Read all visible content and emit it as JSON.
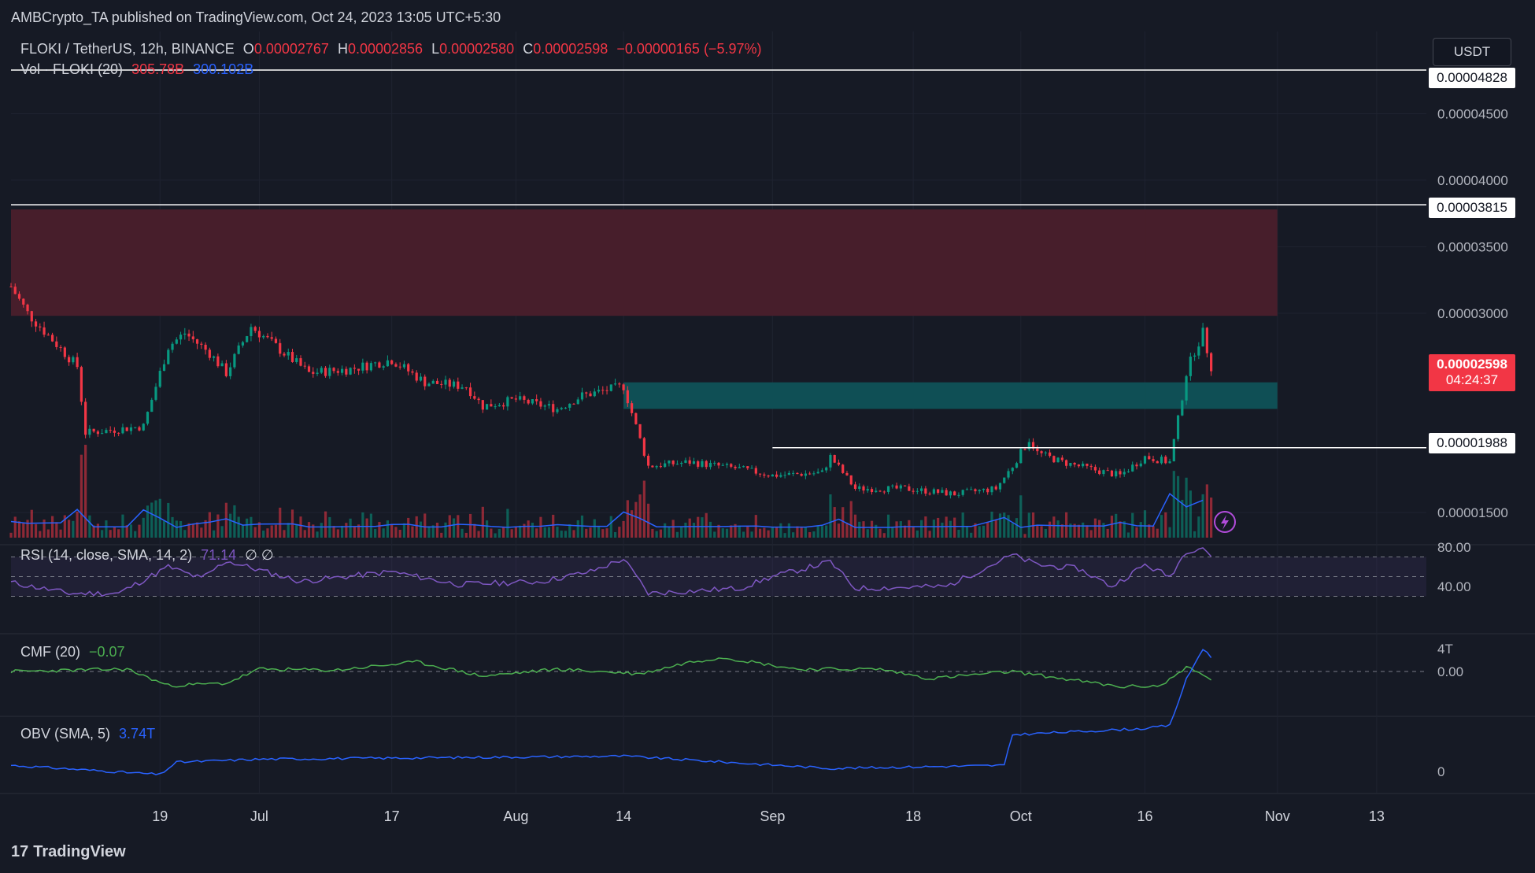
{
  "publisher": "AMBCrypto_TA published on TradingView.com, Oct 24, 2023 13:05 UTC+5:30",
  "symbol": "FLOKI / TetherUS, 12h, BINANCE",
  "ohlc": {
    "o_label": "O",
    "o": "0.00002767",
    "h_label": "H",
    "h": "0.00002856",
    "l_label": "L",
    "l": "0.00002580",
    "c_label": "C",
    "c": "0.00002598",
    "change": "−0.00000165 (−5.97%)"
  },
  "volume": {
    "label": "Vol · FLOKI (20)",
    "value": "305.78B",
    "ma": "300.102B"
  },
  "currency": "USDT",
  "price_axis": [
    "0.00004500",
    "0.00004000",
    "0.00003500",
    "0.00003000",
    "0.00001500"
  ],
  "levels": [
    "0.00004828",
    "0.00003815",
    "0.00001988"
  ],
  "current_price": {
    "value": "0.00002598",
    "countdown": "04:24:37"
  },
  "rsi": {
    "label": "RSI (14, close, SMA, 14, 2)",
    "value": "71.14",
    "extra": "∅ ∅",
    "axis": [
      "80.00",
      "40.00"
    ]
  },
  "cmf": {
    "label": "CMF (20)",
    "value": "−0.07",
    "axis": [
      "0.00"
    ]
  },
  "obv": {
    "label": "OBV (SMA, 5)",
    "value": "3.74T",
    "axis": [
      "4T",
      "0"
    ]
  },
  "time_axis": [
    "19",
    "Jul",
    "17",
    "Aug",
    "14",
    "Sep",
    "18",
    "Oct",
    "16",
    "Nov",
    "13"
  ],
  "brand": "TradingView",
  "colors": {
    "up": "#089981",
    "down": "#f23645",
    "rsi": "#7e57c2",
    "cmf": "#4caf50",
    "obv": "#2962ff",
    "bg": "#161a25"
  },
  "chart_data": {
    "type": "candlestick",
    "pair": "FLOKI/USDT",
    "timeframe": "12h",
    "x_range": [
      "2023-06-01",
      "2023-11-19"
    ],
    "ylim": [
      1.3e-05,
      5e-05
    ],
    "supply_zone": {
      "from": 2.98e-05,
      "to": 3.78e-05,
      "start": "2023-06-01",
      "end": "2023-11-01"
    },
    "demand_zone": {
      "from": 2.28e-05,
      "to": 2.48e-05,
      "start": "2023-08-14",
      "end": "2023-11-01"
    },
    "horizontal_levels": [
      4.828e-05,
      3.815e-05,
      1.988e-05
    ],
    "close_path": [
      [
        "2023-06-01",
        3.2e-05
      ],
      [
        "2023-06-03",
        3e-05
      ],
      [
        "2023-06-06",
        2.8e-05
      ],
      [
        "2023-06-09",
        2.6e-05
      ],
      [
        "2023-06-10",
        2.1e-05
      ],
      [
        "2023-06-13",
        2.12e-05
      ],
      [
        "2023-06-17",
        2.15e-05
      ],
      [
        "2023-06-20",
        2.75e-05
      ],
      [
        "2023-06-22",
        2.85e-05
      ],
      [
        "2023-06-25",
        2.7e-05
      ],
      [
        "2023-06-27",
        2.55e-05
      ],
      [
        "2023-06-30",
        2.9e-05
      ],
      [
        "2023-07-03",
        2.75e-05
      ],
      [
        "2023-07-07",
        2.55e-05
      ],
      [
        "2023-07-12",
        2.58e-05
      ],
      [
        "2023-07-17",
        2.65e-05
      ],
      [
        "2023-07-21",
        2.48e-05
      ],
      [
        "2023-07-26",
        2.45e-05
      ],
      [
        "2023-07-28",
        2.3e-05
      ],
      [
        "2023-08-01",
        2.35e-05
      ],
      [
        "2023-08-06",
        2.28e-05
      ],
      [
        "2023-08-09",
        2.38e-05
      ],
      [
        "2023-08-14",
        2.45e-05
      ],
      [
        "2023-08-15",
        2.25e-05
      ],
      [
        "2023-08-17",
        1.85e-05
      ],
      [
        "2023-08-22",
        1.88e-05
      ],
      [
        "2023-08-28",
        1.83e-05
      ],
      [
        "2023-09-01",
        1.78e-05
      ],
      [
        "2023-09-07",
        1.8e-05
      ],
      [
        "2023-09-08",
        1.92e-05
      ],
      [
        "2023-09-11",
        1.68e-05
      ],
      [
        "2023-09-17",
        1.68e-05
      ],
      [
        "2023-09-23",
        1.64e-05
      ],
      [
        "2023-09-28",
        1.68e-05
      ],
      [
        "2023-09-30",
        1.85e-05
      ],
      [
        "2023-10-02",
        2.05e-05
      ],
      [
        "2023-10-03",
        1.95e-05
      ],
      [
        "2023-10-06",
        1.88e-05
      ],
      [
        "2023-10-10",
        1.82e-05
      ],
      [
        "2023-10-13",
        1.78e-05
      ],
      [
        "2023-10-16",
        1.92e-05
      ],
      [
        "2023-10-19",
        1.88e-05
      ],
      [
        "2023-10-20",
        2.2e-05
      ],
      [
        "2023-10-21",
        2.55e-05
      ],
      [
        "2023-10-22",
        2.72e-05
      ],
      [
        "2023-10-23",
        2.85e-05
      ],
      [
        "2023-10-24",
        2.6e-05
      ]
    ],
    "rsi_path": [
      [
        "2023-06-01",
        44
      ],
      [
        "2023-06-08",
        33
      ],
      [
        "2023-06-14",
        33
      ],
      [
        "2023-06-20",
        60
      ],
      [
        "2023-06-24",
        48
      ],
      [
        "2023-06-27",
        66
      ],
      [
        "2023-07-06",
        45
      ],
      [
        "2023-07-17",
        55
      ],
      [
        "2023-07-25",
        42
      ],
      [
        "2023-08-04",
        45
      ],
      [
        "2023-08-10",
        55
      ],
      [
        "2023-08-14",
        68
      ],
      [
        "2023-08-17",
        33
      ],
      [
        "2023-08-28",
        38
      ],
      [
        "2023-09-01",
        50
      ],
      [
        "2023-09-08",
        65
      ],
      [
        "2023-09-11",
        38
      ],
      [
        "2023-09-22",
        40
      ],
      [
        "2023-09-30",
        72
      ],
      [
        "2023-10-03",
        62
      ],
      [
        "2023-10-08",
        58
      ],
      [
        "2023-10-12",
        40
      ],
      [
        "2023-10-16",
        62
      ],
      [
        "2023-10-19",
        50
      ],
      [
        "2023-10-21",
        76
      ],
      [
        "2023-10-23",
        80
      ],
      [
        "2023-10-24",
        71
      ]
    ],
    "cmf_path": [
      [
        "2023-06-01",
        0.0
      ],
      [
        "2023-06-15",
        0.02
      ],
      [
        "2023-06-20",
        -0.12
      ],
      [
        "2023-06-27",
        -0.1
      ],
      [
        "2023-07-01",
        0.02
      ],
      [
        "2023-07-10",
        0.01
      ],
      [
        "2023-07-20",
        0.08
      ],
      [
        "2023-07-28",
        -0.04
      ],
      [
        "2023-08-06",
        0.02
      ],
      [
        "2023-08-16",
        -0.02
      ],
      [
        "2023-08-22",
        0.08
      ],
      [
        "2023-08-26",
        0.12
      ],
      [
        "2023-09-04",
        0.02
      ],
      [
        "2023-09-14",
        0.02
      ],
      [
        "2023-09-20",
        -0.06
      ],
      [
        "2023-09-30",
        0.0
      ],
      [
        "2023-10-06",
        -0.06
      ],
      [
        "2023-10-13",
        -0.13
      ],
      [
        "2023-10-18",
        -0.12
      ],
      [
        "2023-10-21",
        0.04
      ],
      [
        "2023-10-24",
        -0.07
      ]
    ],
    "obv_path": [
      [
        "2023-06-01",
        0.2
      ],
      [
        "2023-06-19",
        -0.1
      ],
      [
        "2023-06-21",
        0.3
      ],
      [
        "2023-07-01",
        0.4
      ],
      [
        "2023-08-14",
        0.5
      ],
      [
        "2023-09-08",
        0.1
      ],
      [
        "2023-09-29",
        0.2
      ],
      [
        "2023-09-30",
        1.2
      ],
      [
        "2023-10-16",
        1.4
      ],
      [
        "2023-10-19",
        1.5
      ],
      [
        "2023-10-21",
        3.0
      ],
      [
        "2023-10-23",
        4.0
      ],
      [
        "2023-10-24",
        3.74
      ]
    ]
  }
}
